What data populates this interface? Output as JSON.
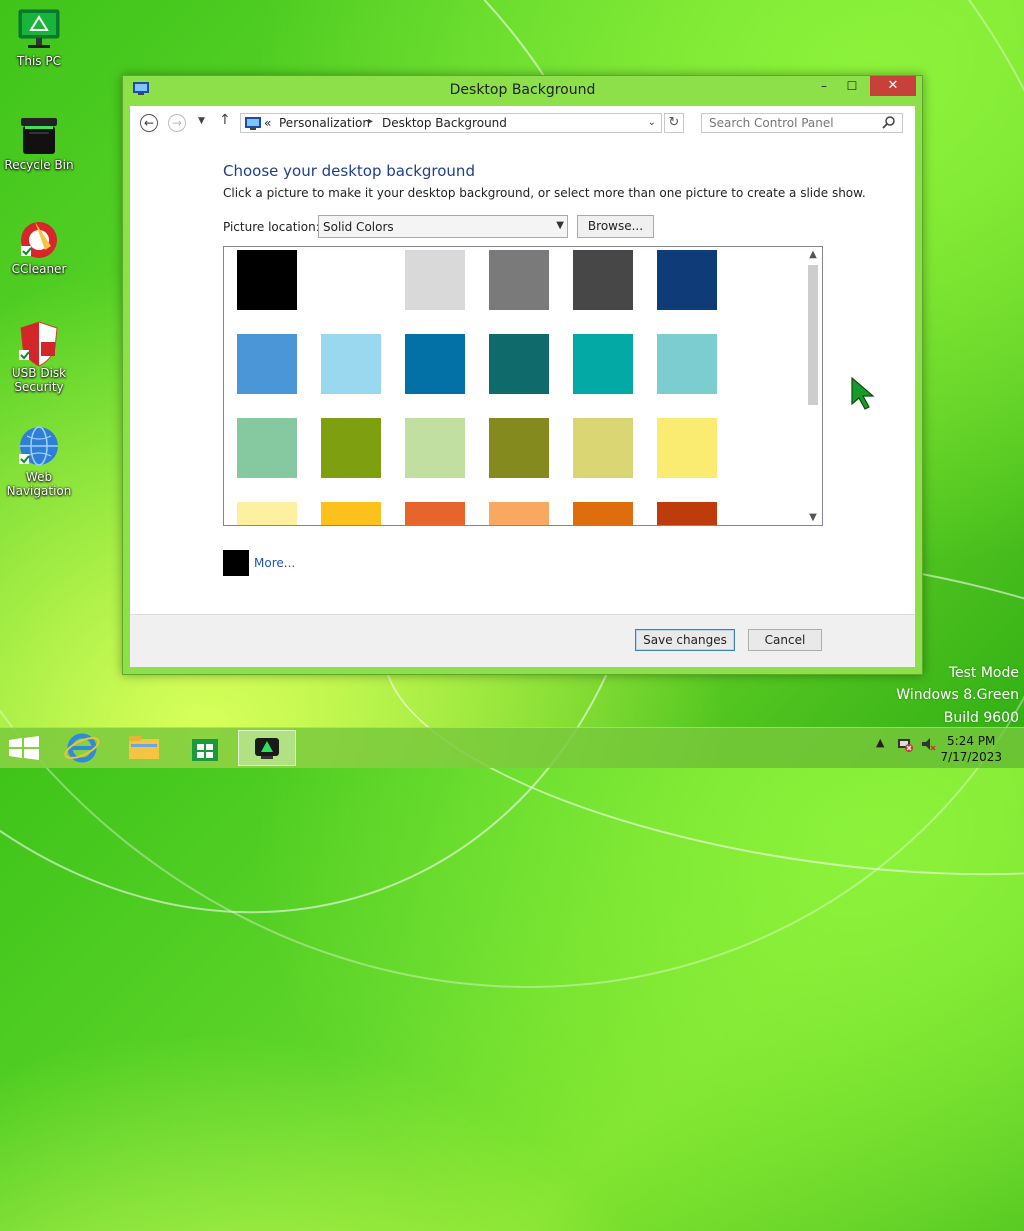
{
  "desktop": {
    "icons": [
      {
        "label": "This PC",
        "icon": "monitor-icon"
      },
      {
        "label": "Recycle Bin",
        "icon": "recycle-bin-icon"
      },
      {
        "label": "CCleaner",
        "icon": "ccleaner-icon"
      },
      {
        "label": "USB Disk Security",
        "icon": "shield-icon"
      },
      {
        "label": "Web Navigation",
        "icon": "globe-icon"
      }
    ],
    "watermark": {
      "line1": "Test Mode",
      "line2": "Windows 8.Green",
      "line3": "Build 9600"
    }
  },
  "window": {
    "title": "Desktop Background",
    "buttons": {
      "minimize": "–",
      "maximize": "☐",
      "close": "✕"
    },
    "address": {
      "prefix": "«",
      "crumbs": [
        "Personalization",
        "Desktop Background"
      ],
      "separator": "▸"
    },
    "search": {
      "placeholder": "Search Control Panel"
    },
    "heading": "Choose your desktop background",
    "description": "Click a picture to make it your desktop background, or select more than one picture to create a slide show.",
    "picture_location": {
      "label": "Picture location:",
      "value": "Solid Colors"
    },
    "browse_label": "Browse...",
    "swatches": [
      [
        "#000000",
        "#ffffff",
        "#d9d9d9",
        "#7a7a7a",
        "#474747",
        "#0f3b78"
      ],
      [
        "#4a96d6",
        "#9ad8ef",
        "#0471a6",
        "#0f6b6b",
        "#03aaa5",
        "#7ccdcf"
      ],
      [
        "#86c9a0",
        "#7d9f10",
        "#c1dfa0",
        "#848a1d",
        "#dad674",
        "#faec70"
      ],
      [
        "#fdf0a0",
        "#fcc11a",
        "#e7642a",
        "#f8a860",
        "#e06d0d",
        "#be3b0b"
      ]
    ],
    "more": {
      "label": "More...",
      "color": "#000000"
    },
    "footer": {
      "save": "Save changes",
      "cancel": "Cancel"
    }
  },
  "taskbar": {
    "items": [
      "start-icon",
      "internet-explorer-icon",
      "file-explorer-icon",
      "store-icon",
      "personalization-icon"
    ],
    "clock": {
      "time": "5:24 PM",
      "date": "7/17/2023"
    }
  },
  "colors": {
    "accent_frame": "#8ee04a",
    "close": "#c7413a",
    "heading": "#1e3f8a",
    "link": "#1e56b0"
  }
}
